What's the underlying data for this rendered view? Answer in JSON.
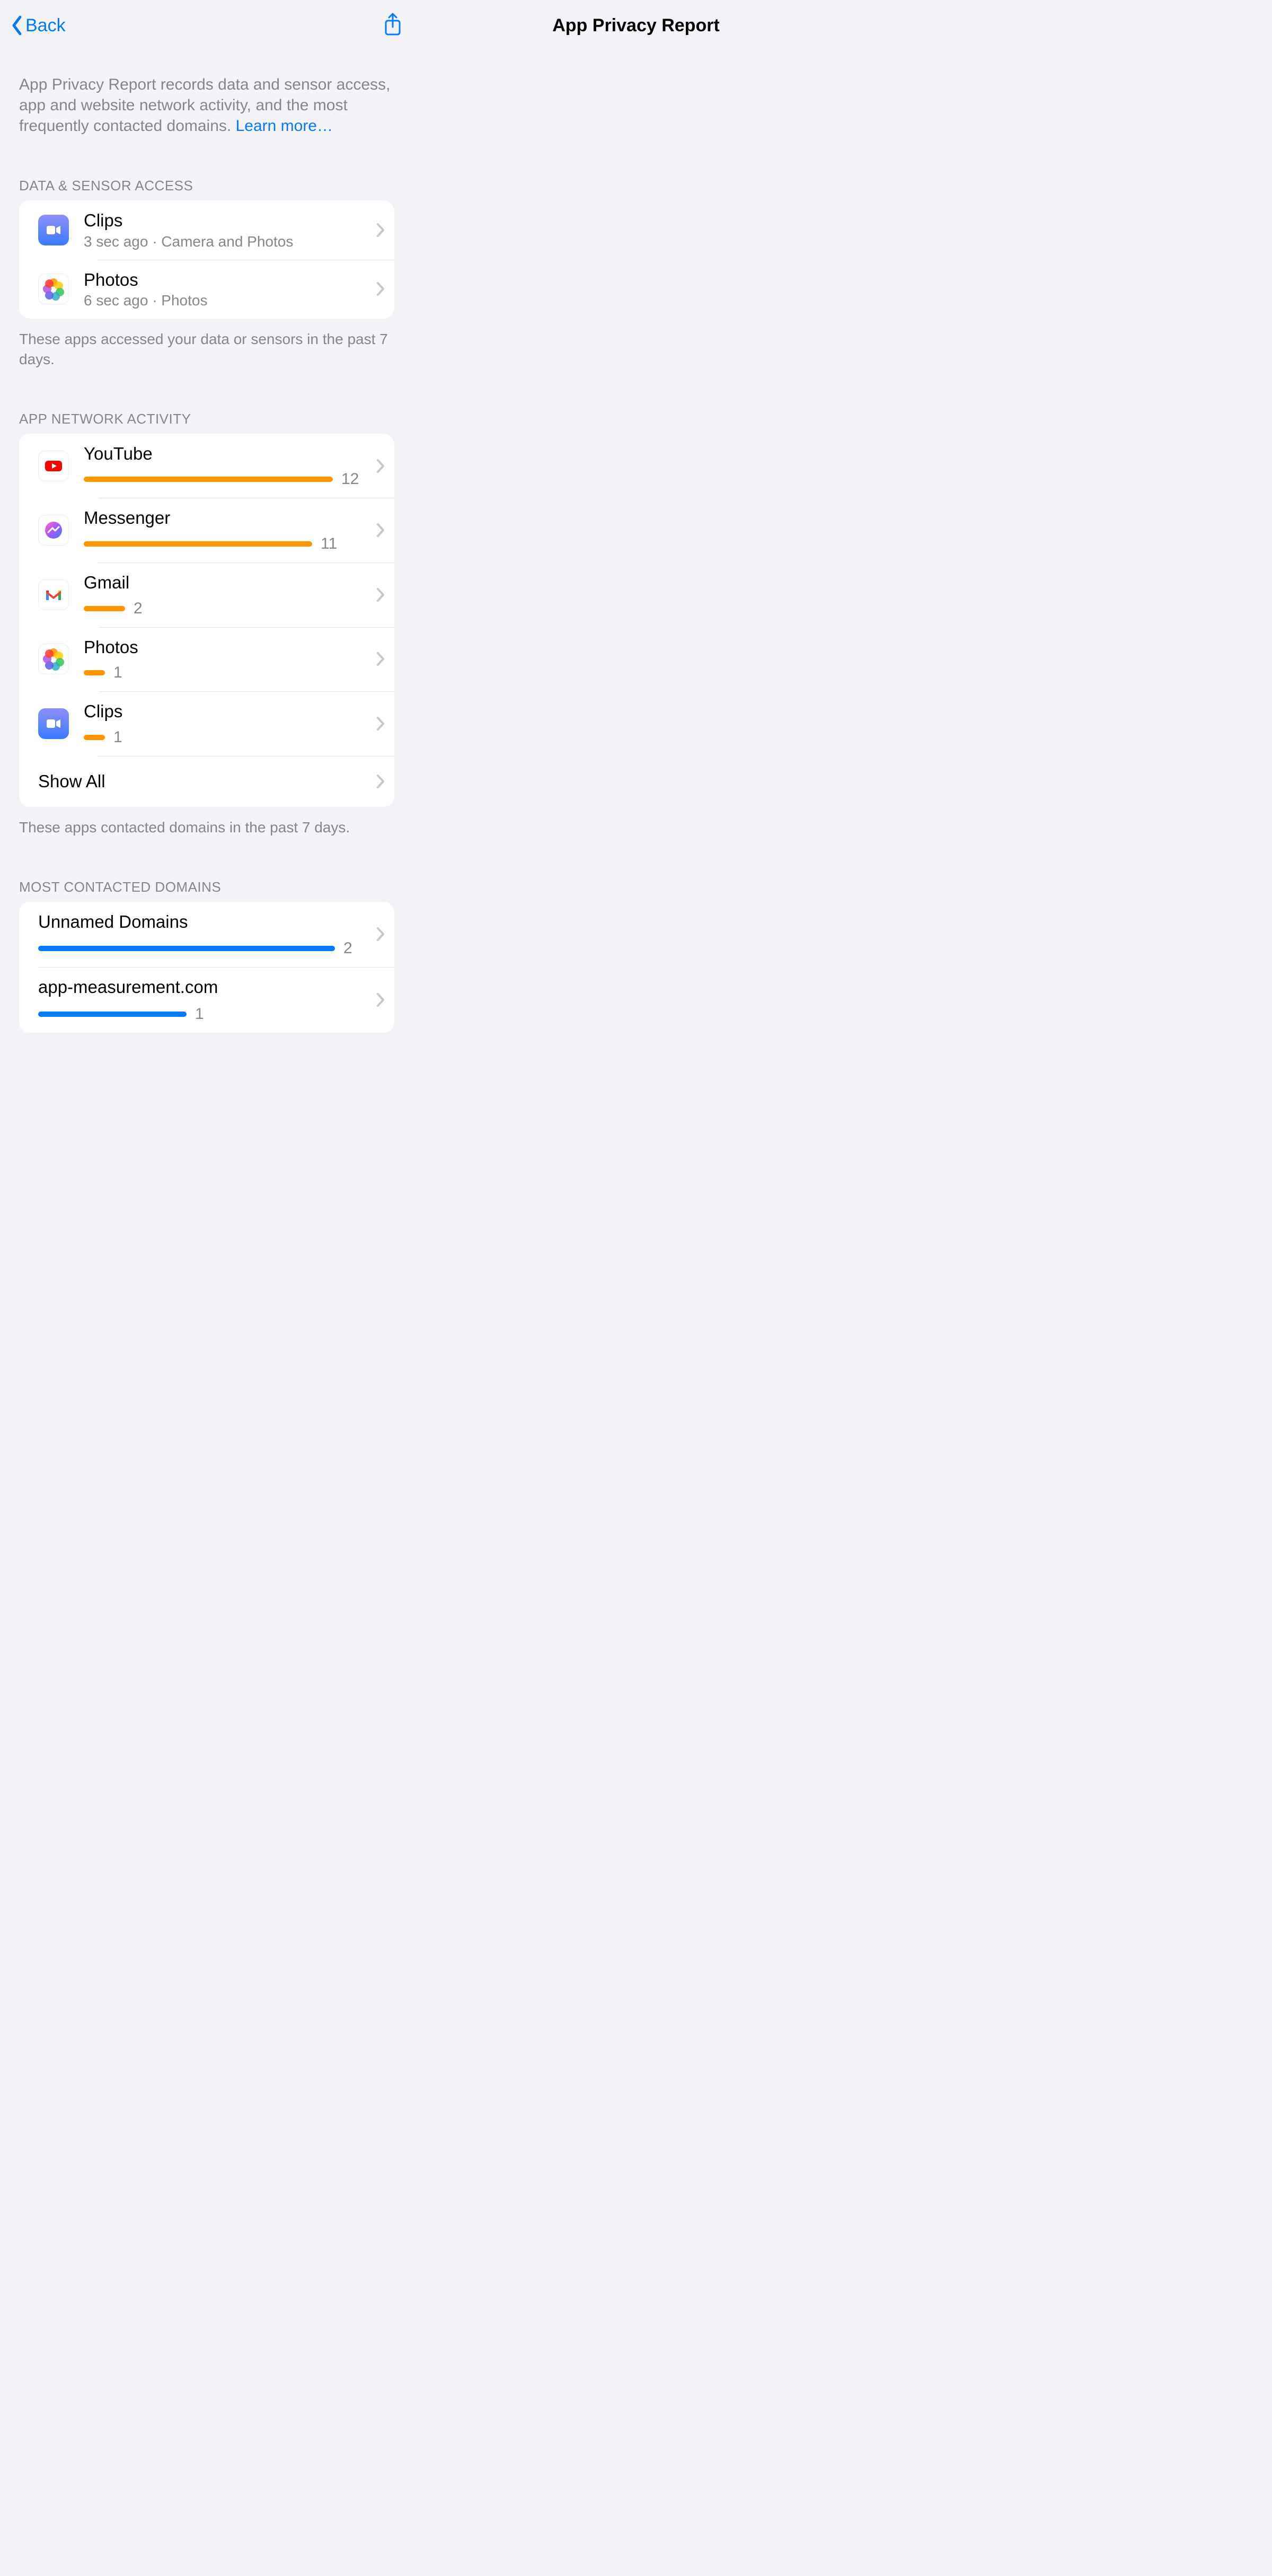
{
  "nav": {
    "back_label": "Back",
    "title": "App Privacy Report"
  },
  "intro": {
    "text": "App Privacy Report records data and sensor access, app and website network activity, and the most frequently contacted domains. ",
    "link_label": "Learn more…"
  },
  "section_data_sensor": {
    "header": "DATA & SENSOR ACCESS",
    "footer": "These apps accessed your data or sensors in the past 7 days.",
    "items": [
      {
        "name": "Clips",
        "sub": "3 sec ago · Camera and Photos",
        "icon": "clips"
      },
      {
        "name": "Photos",
        "sub": "6 sec ago · Photos",
        "icon": "photos"
      }
    ]
  },
  "section_app_network": {
    "header": "APP NETWORK ACTIVITY",
    "footer": "These apps contacted domains in the past 7 days.",
    "bar_color": "#ff9500",
    "max": 12,
    "full_width": 470,
    "items": [
      {
        "name": "YouTube",
        "count": 12,
        "icon": "youtube"
      },
      {
        "name": "Messenger",
        "count": 11,
        "icon": "messenger"
      },
      {
        "name": "Gmail",
        "count": 2,
        "icon": "gmail"
      },
      {
        "name": "Photos",
        "count": 1,
        "icon": "photos"
      },
      {
        "name": "Clips",
        "count": 1,
        "icon": "clips"
      }
    ],
    "show_all_label": "Show All"
  },
  "section_domains": {
    "header": "MOST CONTACTED DOMAINS",
    "bar_color": "#007aff",
    "max": 2,
    "full_width": 560,
    "items": [
      {
        "name": "Unnamed Domains",
        "count": 2
      },
      {
        "name": "app-measurement.com",
        "count": 1
      }
    ]
  }
}
